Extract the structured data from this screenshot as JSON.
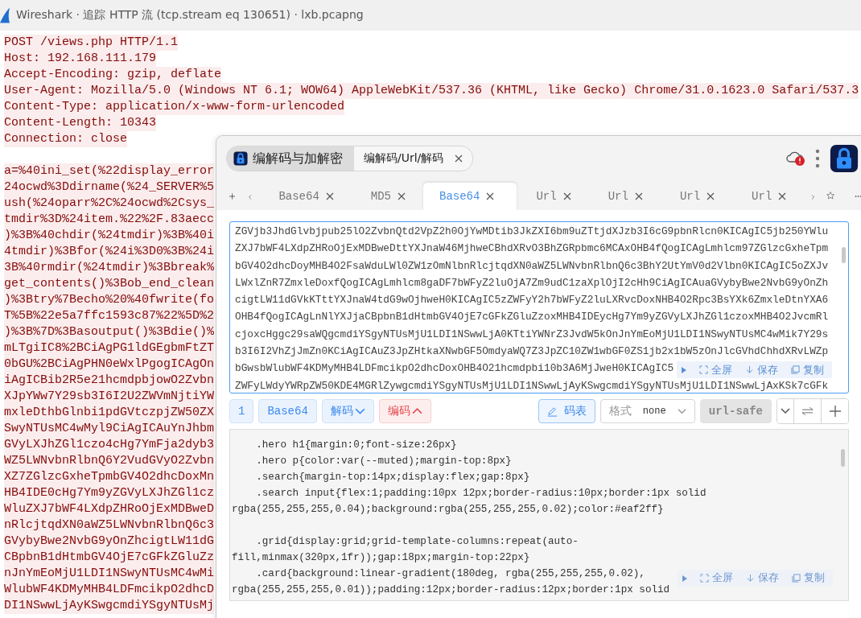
{
  "window": {
    "title": "Wireshark · 追踪 HTTP 流 (tcp.stream eq 130651) · lxb.pcapng"
  },
  "stream": {
    "header_lines": [
      "POST /views.php HTTP/1.1",
      "Host: 192.168.111.179",
      "Accept-Encoding: gzip, deflate",
      "User-Agent: Mozilla/5.0 (Windows NT 6.1; WOW64) AppleWebKit/537.36 (KHTML, like Gecko) Chrome/31.0.1623.0 Safari/537.3",
      "Content-Type: application/x-www-form-urlencoded",
      "Content-Length: 10343",
      "Connection: close"
    ],
    "body_lines": [
      "a=%40ini_set(%22display_error",
      "24ocwd%3Ddirname(%24_SERVER%5",
      "ush(%24oparr%2C%24ocwd%2Csys_",
      "tmdir%3D%24item.%22%2F.83aecc",
      ")%3B%40chdir(%24tmdir)%3B%40i",
      "4tmdir)%3Bfor(%24i%3D0%3B%24i",
      "3B%40rmdir(%24tmdir)%3Bbreak%",
      "get_contents()%3Bob_end_clean",
      ")%3Btry%7Becho%20%40fwrite(fo",
      "T%5B%22e5a7ffc1593c87%22%5D%2",
      ")%3B%7D%3Basoutput()%3Bdie()%",
      "mLTgiIC8%2BCiAgPG1ldGEgbmFtZT",
      "0bGU%2BCiAgPHN0eWxlPgogICAgOn",
      "iAgICBib2R5e21hcmdpbjowO2Zvbn",
      "XJpYWw7Y29sb3I6I2U2ZWVmNjtiYW",
      "mxleDthbGlnbi1pdGVtczpjZW50ZX",
      "SwyNTUsMC4wMyl9CiAgICAuYnJhbm",
      "GVyLXJhZGl1czo4cHg7YmFja2dyb3",
      "WZ5LWNvbnRlbnQ6Y2VudGVyO2Zvbn",
      "XZ7ZGlzcGxheTpmbGV4O2dhcDoxMn",
      "HB4IDE0cHg7Ym9yZGVyLXJhZGl1cz",
      "WluZXJ7bWF4LXdpZHRoOjExMDBweD",
      "nRlcjtqdXN0aWZ5LWNvbnRlbnQ6c3",
      "GVybyBwe2NvbG9yOnZhcigtLW11dG",
      "CBpbnB1dHtmbGV4OjE7cGFkZGluZz",
      "nJnYmEoMjU1LDI1NSwyNTUsMC4wMi",
      "WlubWF4KDMyMHB4LDFmcikpO2dhcD",
      "DI1NSwwLjAyKSwgcmdiYSgyNTUsMj"
    ]
  },
  "tool_panel": {
    "breadcrumb": {
      "root": "编解码与加解密",
      "current": "编解码/Url/解码"
    },
    "tabs": [
      {
        "label": "Base64",
        "selected": false
      },
      {
        "label": "MD5",
        "selected": false
      },
      {
        "label": "Base64",
        "selected": true
      },
      {
        "label": "Url",
        "selected": false
      },
      {
        "label": "Url",
        "selected": false
      },
      {
        "label": "Url",
        "selected": false
      },
      {
        "label": "Url",
        "selected": false
      }
    ],
    "input": {
      "lines": [
        "ZGVjb3JhdGlvbjpub25lO2ZvbnQtd2VpZ2h0OjYwMDtib3JkZXI6bm9uZTtjdXJzb3I6cG9pbnRlcn0KICAgIC5jb250YWlu",
        "ZXJ7bWF4LXdpZHRoOjExMDBweDttYXJnaW46MjhweCBhdXRvO3BhZGRpbmc6MCAxOHB4fQogICAgLmhlcm97ZGlzcGxheTpm",
        "bGV4O2dhcDoyMHB4O2FsaWduLWl0ZW1zOmNlbnRlcjtqdXN0aWZ5LWNvbnRlbnQ6c3BhY2UtYmV0d2Vlbn0KICAgIC5oZXJv",
        "LWxlZnR7ZmxleDoxfQogICAgLmhlcm8gaDF7bWFyZ2luOjA7Zm9udC1zaXplOjI2cHh9CiAgICAuaGVybyBwe2NvbG9yOnZh",
        "cigtLW11dGVkKTttYXJnaW4tdG9wOjhweH0KICAgIC5zZWFyY2h7bWFyZ2luLXRvcDoxNHB4O2Rpc3BsYXk6ZmxleDtnYXA6",
        "OHB4fQogICAgLnNlYXJjaCBpbnB1dHtmbGV4OjE7cGFkZGluZzoxMHB4IDEycHg7Ym9yZGVyLXJhZGl1czoxMHB4O2JvcmRl",
        "cjoxcHggc29saWQgcmdiYSgyNTUsMjU1LDI1NSwwLjA0KTtiYWNrZ3JvdW5kOnJnYmEoMjU1LDI1NSwyNTUsMC4wMik7Y29s",
        "b3I6I2VhZjJmZn0KCiAgICAuZ3JpZHtkaXNwbGF5OmdyaWQ7Z3JpZC10ZW1wbGF0ZS1jb2x1bW5zOnJlcGVhdChhdXRvLWZp",
        "bGwsbWlubWF4KDMyMHB4LDFmcikpO2dhcDoxOHB4O21hcmdpbi10b3A6MjJweH0KICAgIC5",
        "ZWFyLWdyYWRpZW50KDE4MGRlZywgcmdiYSgyNTUsMjU1LDI1NSwwLjAyKSwgcmdiYSgyNTUsMjU1LDI1NSwwLjAxKSk7cGFk"
      ]
    },
    "input_actions": [
      "全屏",
      "保存",
      "复制"
    ],
    "toolbar": {
      "line_number": "1",
      "mode": "Base64",
      "decode": "解码",
      "encode": "编码",
      "charset": "码表",
      "format_label": "格式",
      "format_value": "none",
      "url_safe": "url-safe"
    },
    "output": {
      "blocks": [
        [
          "    .hero h1{margin:0;font-size:26px}",
          "    .hero p{color:var(--muted);margin-top:8px}",
          "    .search{margin-top:14px;display:flex;gap:8px}",
          "    .search input{flex:1;padding:10px 12px;border-radius:10px;border:1px solid",
          "rgba(255,255,255,0.04);background:rgba(255,255,255,0.02);color:#eaf2ff}"
        ],
        [
          "    .grid{display:grid;grid-template-columns:repeat(auto-",
          "fill,minmax(320px,1fr));gap:18px;margin-top:22px}",
          "    .card{background:linear-gradient(180deg, rgba(255,255,255,0.02),",
          "rgba(255,255,255,0.01));padding:12px;border-radius:12px;border:1px solid"
        ]
      ]
    },
    "output_actions": [
      "全屏",
      "保存",
      "复制"
    ]
  }
}
